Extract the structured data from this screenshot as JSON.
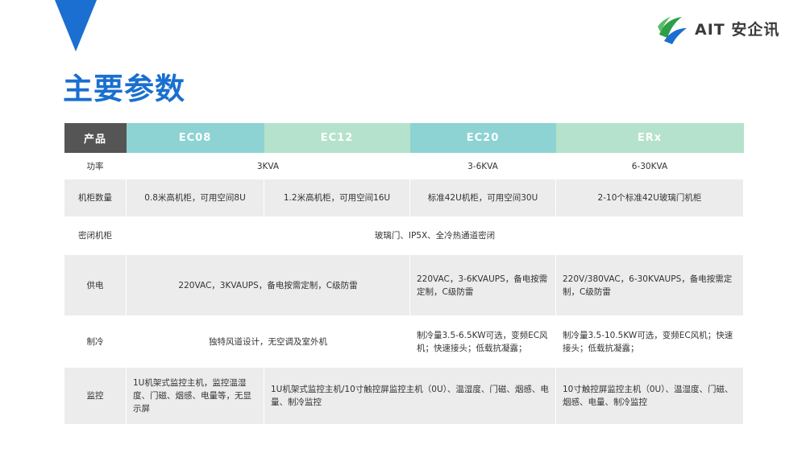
{
  "page": {
    "title": "主要参数",
    "logo": {
      "text": "AIT 安企讯",
      "brand_green": "#2e9e48",
      "brand_blue": "#1a6fd0"
    },
    "accent_color": "#1a6fd0"
  },
  "table": {
    "headers": [
      "产品",
      "EC08",
      "EC12",
      "EC20",
      "ERx"
    ],
    "rows": {
      "power": {
        "label": "功率",
        "ec08_12": "3KVA",
        "ec20": "3-6KVA",
        "erx": "6-30KVA"
      },
      "cabinet": {
        "label": "机柜数量",
        "ec08": "0.8米高机柜，可用空间8U",
        "ec12": "1.2米高机柜，可用空间16U",
        "ec20": "标准42U机柜，可用空间30U",
        "erx": "2-10个标准42U玻璃门机柜"
      },
      "sealed": {
        "label": "密闭机柜",
        "all": "玻璃门、IP5X、全冷热通道密闭"
      },
      "supply": {
        "label": "供电",
        "ec08_12": "220VAC，3KVAUPS，备电按需定制，C级防雷",
        "ec20": "220VAC，3-6KVAUPS，备电按需定制，C级防雷",
        "erx": "220V/380VAC，6-30KVAUPS，备电按需定制，C级防雷"
      },
      "cooling": {
        "label": "制冷",
        "ec08_12": "独特风道设计，无空调及室外机",
        "ec20": "制冷量3.5-6.5KW可选，变频EC风机；快速接头；低载抗凝露；",
        "erx": "制冷量3.5-10.5KW可选，变频EC风机；快速接头；低载抗凝露；"
      },
      "monitor": {
        "label": "监控",
        "ec08": "1U机架式监控主机，监控温湿度、门磁、烟感、电量等，无显示屏",
        "ec12_20": "1U机架式监控主机/10寸触控屏监控主机（0U）、温湿度、门磁、烟感、电量、制冷监控",
        "erx": "10寸触控屏监控主机（0U）、温湿度、门磁、烟感、电量、制冷监控"
      }
    }
  }
}
